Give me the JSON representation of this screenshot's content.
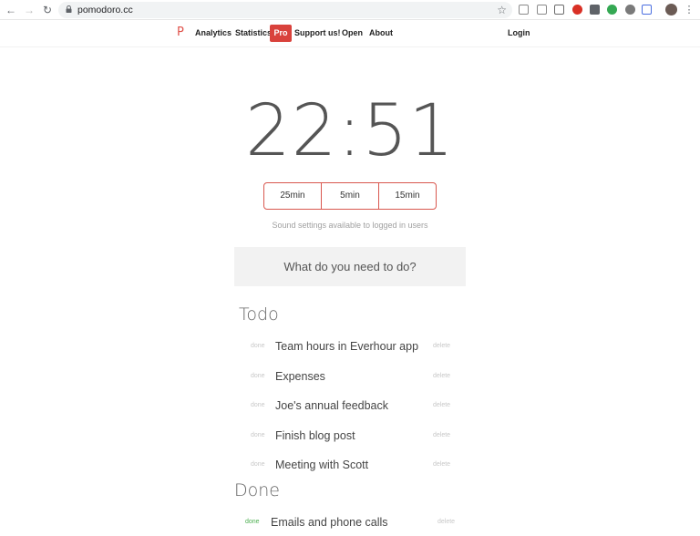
{
  "browser": {
    "url": "pomodoro.cc",
    "extensions": [
      {
        "name": "moon-ext-icon",
        "color": "#8a8a8a"
      },
      {
        "name": "camera-icon",
        "color": "#8a8a8a"
      },
      {
        "name": "screenshot-frame-icon",
        "color": "#6a6a6a"
      },
      {
        "name": "stop-ext-icon",
        "color": "#d93025"
      },
      {
        "name": "square-ext-icon",
        "color": "#5f6368"
      },
      {
        "name": "green-ext-icon",
        "color": "#34a853"
      },
      {
        "name": "shield-ext-icon",
        "color": "#7a7a7a"
      },
      {
        "name": "grid-ext-icon",
        "color": "#4a6ee0"
      }
    ]
  },
  "nav": {
    "logo": "P",
    "links": [
      "Analytics",
      "Statistics",
      "Pro",
      "Support us!",
      "Open",
      "About"
    ],
    "login": "Login"
  },
  "timer": {
    "display": "22:51",
    "durations": [
      "25min",
      "5min",
      "15min"
    ],
    "sound_note": "Sound settings available to logged in users"
  },
  "task_input": {
    "placeholder": "What do you need to do?"
  },
  "todo": {
    "title": "Todo",
    "done_label": "done",
    "delete_label": "delete",
    "items": [
      "Team hours in Everhour app",
      "Expenses",
      "Joe's annual feedback",
      "Finish blog post",
      "Meeting with Scott"
    ]
  },
  "done_section": {
    "title": "Done",
    "done_label": "done",
    "delete_label": "delete",
    "items": [
      "Emails and phone calls"
    ]
  },
  "colors": {
    "accent": "#d9423c",
    "done_green": "#4caf50"
  }
}
